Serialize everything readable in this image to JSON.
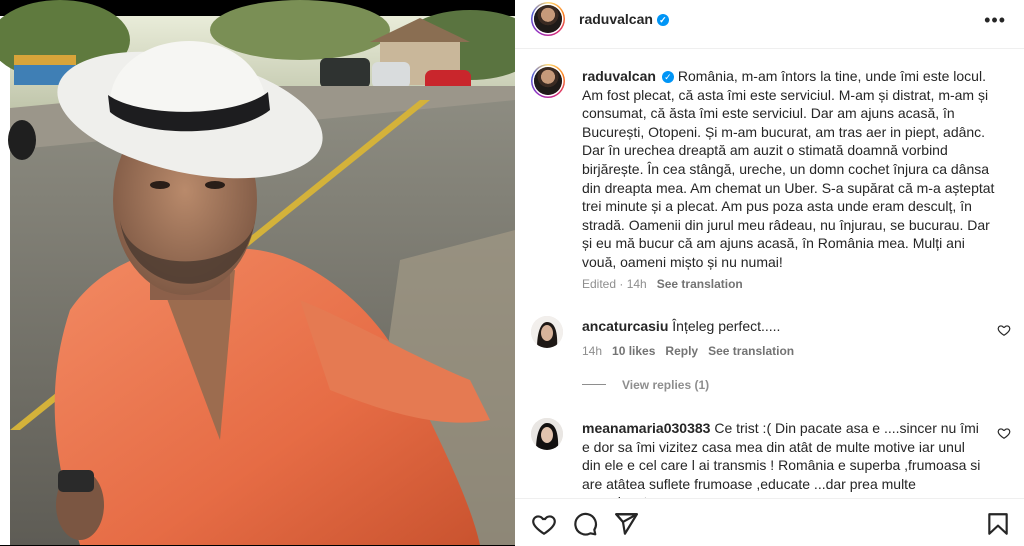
{
  "post": {
    "username": "raduvalcan",
    "verified": true,
    "more_icon": "more-horizontal-icon"
  },
  "caption": {
    "username": "raduvalcan",
    "text": "România, m-am întors la tine, unde îmi este locul. Am fost plecat, că asta îmi este serviciul. M-am și distrat, m-am și consumat, că ăsta îmi este serviciul. Dar am ajuns acasă, în București, Otopeni. Și m-am bucurat, am tras aer in piept, adânc. Dar în urechea dreaptă am auzit o stimată doamnă vorbind birjărește. În cea stângă, ureche, un domn cochet înjura ca dânsa din dreapta mea. Am chemat un Uber. S-a supărat că m-a așteptat trei minute și a plecat. Am pus poza asta unde eram desculț, în stradă. Oamenii din jurul meu râdeau, nu înjurau, se bucurau. Dar și eu mă bucur că am ajuns acasă, în România mea. Mulți ani vouă, oameni mișto și nu numai!",
    "edited": "Edited · 14h",
    "see_translation": "See translation"
  },
  "comments": [
    {
      "username": "ancaturcasiu",
      "text": "Înțeleg perfect.....",
      "time": "14h",
      "likes": "10 likes",
      "reply": "Reply",
      "see_translation": "See translation",
      "view_replies": "View replies (1)"
    },
    {
      "username": "meanamaria030383",
      "text": "Ce trist :( Din pacate asa e ....sincer nu îmi e dor sa îmi vizitez casa mea din atât de multe motive iar unul din ele e cel care l ai transmis ! România e superba ,frumoasa si are atâtea suflete frumoase ,educate ...dar prea multe neeeducate..."
    }
  ],
  "actions": {
    "like_icon": "heart-icon",
    "comment_icon": "comment-icon",
    "share_icon": "send-icon",
    "save_icon": "bookmark-icon"
  },
  "colors": {
    "verified": "#0095f6",
    "text": "#262626",
    "muted": "#8e8e8e"
  }
}
